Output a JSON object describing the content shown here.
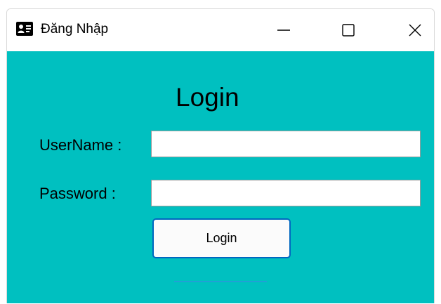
{
  "window": {
    "title": "Đăng Nhập",
    "app_icon": "id-card-icon",
    "controls": {
      "minimize_icon": "minimize-icon",
      "maximize_icon": "maximize-icon",
      "close_icon": "close-icon"
    }
  },
  "form": {
    "heading": "Login",
    "username_label": "UserName :",
    "username_value": "",
    "password_label": "Password :",
    "password_value": "",
    "login_button": "Login"
  },
  "colors": {
    "client_background": "#00c0c0",
    "button_border_accent": "#0067c0"
  }
}
